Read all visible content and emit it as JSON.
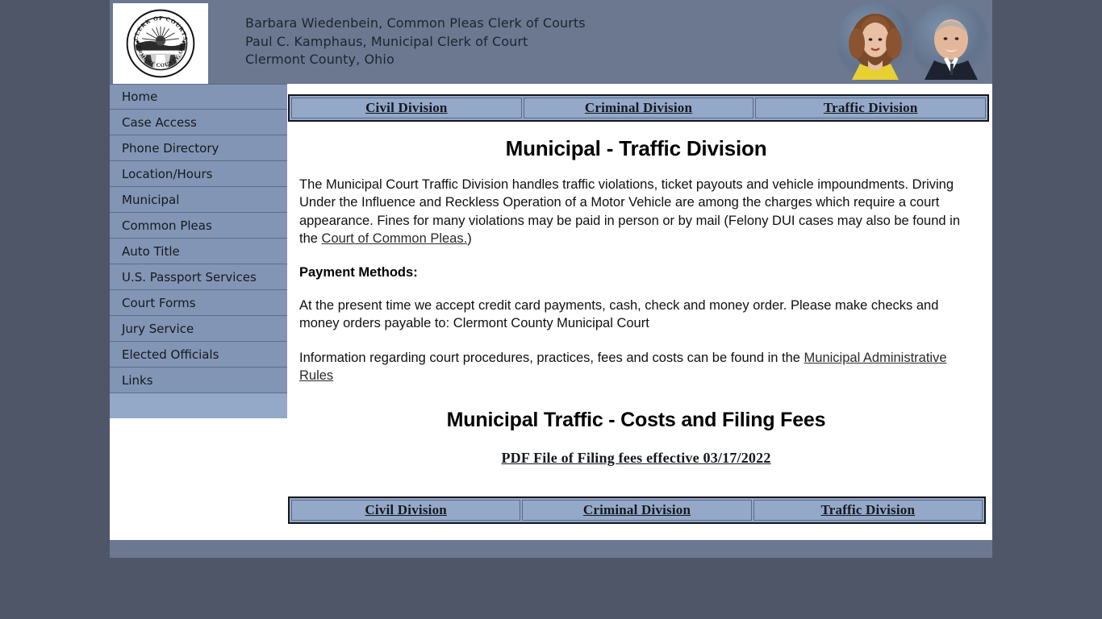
{
  "masthead": {
    "logo_alt": "Clerk of Courts, Clermont County, Ohio seal",
    "seal_top_text": "CLERK OF COURTS",
    "seal_bottom_text": "CLERMONT COUNTY, OHIO",
    "line1": "Barbara Wiedenbein, Common Pleas Clerk of Courts",
    "line2": "Paul C. Kamphaus, Municipal Clerk of Court",
    "line3": "Clermont County, Ohio"
  },
  "sidebar": {
    "items": [
      {
        "label": "Home"
      },
      {
        "label": "Case Access"
      },
      {
        "label": "Phone Directory"
      },
      {
        "label": "Location/Hours"
      },
      {
        "label": "Municipal"
      },
      {
        "label": "Common Pleas"
      },
      {
        "label": "Auto Title"
      },
      {
        "label": "U.S. Passport Services"
      },
      {
        "label": "Court Forms"
      },
      {
        "label": "Jury Service"
      },
      {
        "label": "Elected Officials"
      },
      {
        "label": "Links"
      }
    ],
    "blank_item": ""
  },
  "tabs": [
    {
      "label": "Civil Division"
    },
    {
      "label": "Criminal Division"
    },
    {
      "label": "Traffic Division"
    }
  ],
  "main": {
    "page_title": "Municipal - Traffic Division",
    "intro_part1": "The Municipal Court Traffic Division handles traffic violations, ticket payouts and vehicle impoundments. Driving Under the Influence and Reckless Operation of a Motor Vehicle are among the charges which require a court appearance. Fines for many violations may be paid in person or by mail (Felony DUI cases may also be found in the ",
    "intro_link": "Court of Common Pleas.",
    "intro_part2": ")",
    "payment_heading": "Payment Methods:",
    "payment_text": "At the present time we accept credit card payments, cash, check and money order. Please make checks and money orders payable to: Clermont County Municipal Court",
    "rules_part1": "Information regarding court procedures, practices, fees and costs can be found in the ",
    "rules_link": "Municipal Administrative Rules",
    "costs_title": "Municipal Traffic - Costs and Filing Fees",
    "pdf_link": "PDF File of Filing fees effective 03/17/2022"
  },
  "colors": {
    "page_background": "#4e5668",
    "masthead_band": "#6b7890",
    "sidebar_item": "#8295b4",
    "sidebar_blank": "#94a8c8",
    "tab_cell": "#94a8c8",
    "content_background": "#ffffff",
    "text": "#101010"
  }
}
